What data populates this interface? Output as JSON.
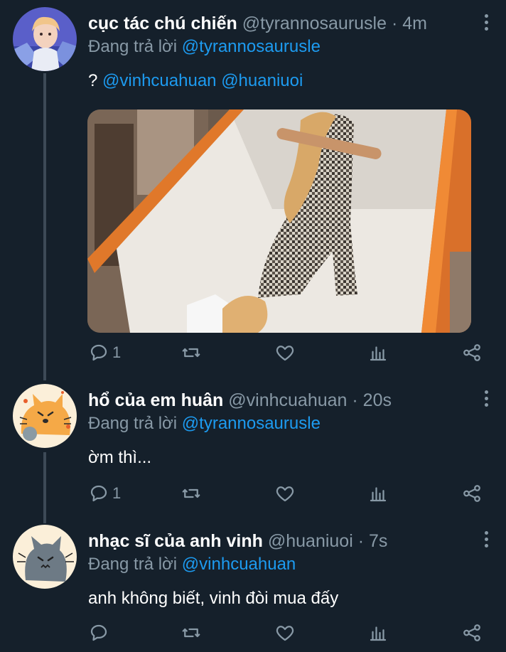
{
  "tweets": [
    {
      "name": "cục tác chú chiến",
      "handle": "@tyrannosaurusle",
      "time": "· 4m",
      "reply_prefix": "Đang trả lời",
      "reply_to": "@tyrannosaurusle",
      "text_prefix": "?",
      "mentions": [
        "@vinhcuahuan",
        "@huaniuoi"
      ],
      "reply_count": "1",
      "has_media": true
    },
    {
      "name": "hổ của em huân",
      "handle": "@vinhcuahuan",
      "time": "· 20s",
      "reply_prefix": "Đang trả lời",
      "reply_to": "@tyrannosaurusle",
      "text": "ờm thì...",
      "reply_count": "1"
    },
    {
      "name": "nhạc sĩ của anh vinh",
      "handle": "@huaniuoi",
      "time": "· 7s",
      "reply_prefix": "Đang trả lời",
      "reply_to": "@vinhcuahuan",
      "text": "anh không biết, vinh đòi mua đấy",
      "reply_count": ""
    }
  ],
  "icons": {
    "reply": "reply-icon",
    "retweet": "retweet-icon",
    "like": "like-icon",
    "analytics": "analytics-icon",
    "share": "share-icon",
    "more": "more-vertical-icon"
  },
  "colors": {
    "background": "#15202b",
    "text": "#ffffff",
    "secondary": "#8899a6",
    "link": "#1d9bf0",
    "thread_line": "#3d4a57"
  }
}
